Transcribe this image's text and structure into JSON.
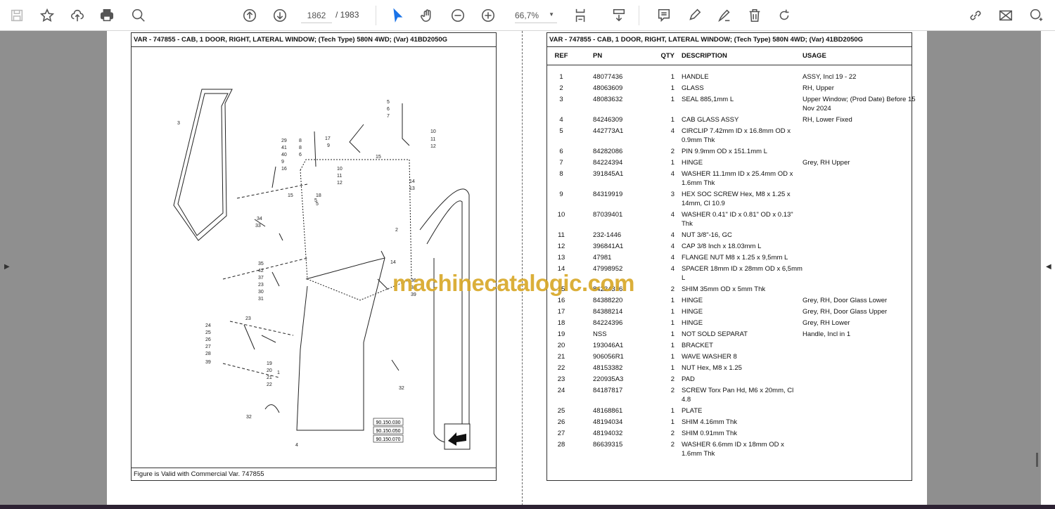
{
  "toolbar": {
    "page_current": "1862",
    "page_total": "/ 1983",
    "zoom": "66,7%"
  },
  "left_page": {
    "title": "VAR - 747855 - CAB, 1 DOOR, RIGHT, LATERAL WINDOW; (Tech Type) 580N 4WD; (Var) 41BD2050G",
    "footer": "Figure is Valid with Commercial Var. 747855",
    "refs": [
      "90.150.030",
      "90.150.050",
      "90.150.070"
    ],
    "callouts": [
      "3",
      "5",
      "6",
      "7",
      "10",
      "11",
      "12",
      "29",
      "41",
      "40",
      "9",
      "16",
      "8",
      "8",
      "6",
      "17",
      "9",
      "15",
      "10",
      "11",
      "12",
      "18",
      "5",
      "14",
      "13",
      "15",
      "2",
      "34",
      "33",
      "35",
      "42",
      "37",
      "23",
      "30",
      "31",
      "14",
      "36",
      "38",
      "39",
      "23",
      "24",
      "25",
      "26",
      "27",
      "28",
      "39",
      "19",
      "20",
      "21",
      "22",
      "1",
      "32",
      "32",
      "4",
      "5"
    ]
  },
  "right_page": {
    "title": "VAR - 747855 - CAB, 1 DOOR, RIGHT, LATERAL WINDOW; (Tech Type) 580N 4WD; (Var) 41BD2050G",
    "headers": {
      "ref": "REF",
      "pn": "PN",
      "qty": "QTY",
      "desc": "DESCRIPTION",
      "usage": "USAGE"
    },
    "rows": [
      {
        "ref": "1",
        "pn": "48077436",
        "qty": "1",
        "desc": "HANDLE",
        "usage": "ASSY, Incl 19 - 22"
      },
      {
        "ref": "2",
        "pn": "48063609",
        "qty": "1",
        "desc": "GLASS",
        "usage": "RH, Upper"
      },
      {
        "ref": "3",
        "pn": "48083632",
        "qty": "1",
        "desc": "SEAL 885,1mm L",
        "usage": "Upper Window; (Prod Date) Before 15 Nov 2024"
      },
      {
        "ref": "4",
        "pn": "84246309",
        "qty": "1",
        "desc": "CAB GLASS ASSY",
        "usage": "RH, Lower Fixed"
      },
      {
        "ref": "5",
        "pn": "442773A1",
        "qty": "4",
        "desc": "CIRCLIP 7.42mm ID x 16.8mm OD x 0.9mm Thk",
        "usage": ""
      },
      {
        "ref": "6",
        "pn": "84282086",
        "qty": "2",
        "desc": "PIN 9.9mm OD x 151.1mm L",
        "usage": ""
      },
      {
        "ref": "7",
        "pn": "84224394",
        "qty": "1",
        "desc": "HINGE",
        "usage": "Grey, RH Upper"
      },
      {
        "ref": "8",
        "pn": "391845A1",
        "qty": "4",
        "desc": "WASHER 11.1mm ID x 25.4mm OD x 1.6mm Thk",
        "usage": ""
      },
      {
        "ref": "9",
        "pn": "84319919",
        "qty": "3",
        "desc": "HEX SOC SCREW Hex, M8 x 1.25 x 14mm, Cl 10.9",
        "usage": ""
      },
      {
        "ref": "10",
        "pn": "87039401",
        "qty": "4",
        "desc": "WASHER 0.41\" ID x 0.81\" OD x 0.13\" Thk",
        "usage": ""
      },
      {
        "ref": "11",
        "pn": "232-1446",
        "qty": "4",
        "desc": "NUT 3/8\"-16, GC",
        "usage": ""
      },
      {
        "ref": "12",
        "pn": "396841A1",
        "qty": "4",
        "desc": "CAP 3/8 Inch x 18.03mm L",
        "usage": ""
      },
      {
        "ref": "13",
        "pn": "47981",
        "qty": "4",
        "desc": "FLANGE NUT M8 x 1.25 x 9,5mm L",
        "usage": ""
      },
      {
        "ref": "14",
        "pn": "47998952",
        "qty": "4",
        "desc": "SPACER 18mm ID x 28mm OD x 6,5mm L",
        "usage": ""
      },
      {
        "ref": "15",
        "pn": "84224336",
        "qty": "2",
        "desc": "SHIM 35mm OD x 5mm Thk",
        "usage": ""
      },
      {
        "ref": "16",
        "pn": "84388220",
        "qty": "1",
        "desc": "HINGE",
        "usage": "Grey, RH, Door Glass Lower"
      },
      {
        "ref": "17",
        "pn": "84388214",
        "qty": "1",
        "desc": "HINGE",
        "usage": "Grey, RH, Door Glass Upper"
      },
      {
        "ref": "18",
        "pn": "84224396",
        "qty": "1",
        "desc": "HINGE",
        "usage": "Grey, RH Lower"
      },
      {
        "ref": "19",
        "pn": "NSS",
        "qty": "1",
        "desc": "NOT SOLD SEPARAT",
        "usage": "Handle, Incl in 1"
      },
      {
        "ref": "20",
        "pn": "193046A1",
        "qty": "1",
        "desc": "BRACKET",
        "usage": ""
      },
      {
        "ref": "21",
        "pn": "906056R1",
        "qty": "1",
        "desc": "WAVE WASHER 8",
        "usage": ""
      },
      {
        "ref": "22",
        "pn": "48153382",
        "qty": "1",
        "desc": "NUT Hex, M8 x 1.25",
        "usage": ""
      },
      {
        "ref": "23",
        "pn": "220935A3",
        "qty": "2",
        "desc": "PAD",
        "usage": ""
      },
      {
        "ref": "24",
        "pn": "84187817",
        "qty": "2",
        "desc": "SCREW Torx Pan Hd, M6 x 20mm, Cl 4.8",
        "usage": ""
      },
      {
        "ref": "25",
        "pn": "48168861",
        "qty": "1",
        "desc": "PLATE",
        "usage": ""
      },
      {
        "ref": "26",
        "pn": "48194034",
        "qty": "1",
        "desc": "SHIM 4.16mm Thk",
        "usage": ""
      },
      {
        "ref": "27",
        "pn": "48194032",
        "qty": "2",
        "desc": "SHIM 0.91mm Thk",
        "usage": ""
      },
      {
        "ref": "28",
        "pn": "86639315",
        "qty": "2",
        "desc": "WASHER 6.6mm ID x 18mm OD x 1.6mm Thk",
        "usage": ""
      }
    ]
  },
  "watermark": "machinecatalogic.com",
  "colors": {
    "watermark": "#d8a92a",
    "select_tool": "#1a73e8",
    "background": "#8f8f8f"
  }
}
